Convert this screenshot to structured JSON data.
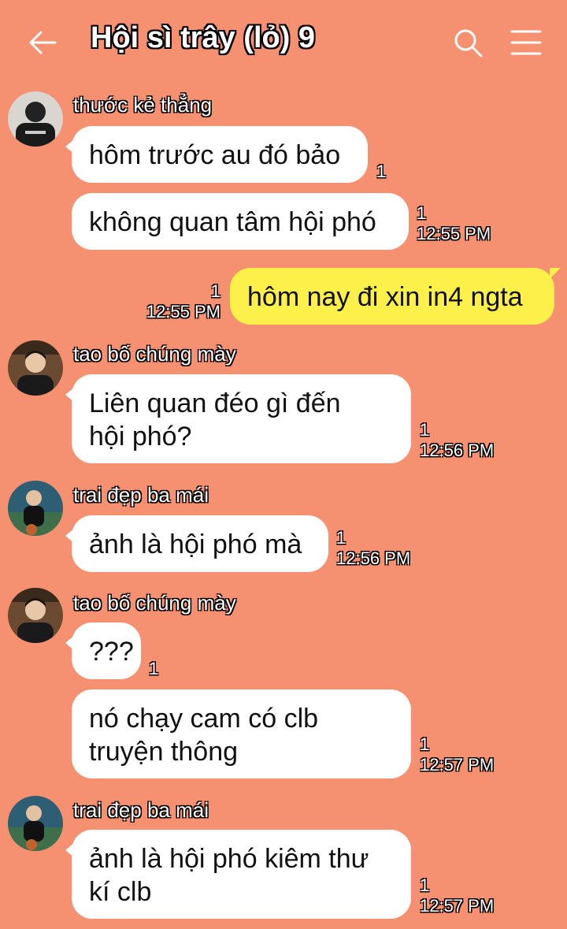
{
  "header": {
    "title": "Hội sì trây (lỏ) 9",
    "back_icon": "arrow-left-icon",
    "search_icon": "search-icon",
    "menu_icon": "hamburger-menu-icon"
  },
  "colors": {
    "background": "#f59070",
    "incoming_bubble": "#ffffff",
    "outgoing_bubble": "#fef04a"
  },
  "messages": [
    {
      "sender": "thước kẻ thẳng",
      "text": "hôm trước au đó bảo",
      "count": "1",
      "time": ""
    },
    {
      "sender": "",
      "text": "không quan tâm hội phó",
      "count": "1",
      "time": "12:55 PM"
    },
    {
      "sender": "me",
      "text": "hôm nay đi xin in4 ngta",
      "count": "1",
      "time": "12:55 PM"
    },
    {
      "sender": "tao bố chúng mày",
      "text": "Liên quan đéo gì đến hội phó?",
      "count": "1",
      "time": "12:56 PM"
    },
    {
      "sender": "trai đẹp ba mái",
      "text": "ảnh là hội phó mà",
      "count": "1",
      "time": "12:56 PM"
    },
    {
      "sender": "tao bố chúng mày",
      "text": "???",
      "count": "1",
      "time": ""
    },
    {
      "sender": "",
      "text": "nó chạy cam có clb truyện thông",
      "count": "1",
      "time": "12:57 PM"
    },
    {
      "sender": "trai đẹp ba mái",
      "text": "ảnh là hội phó kiêm thư kí clb",
      "count": "1",
      "time": "12:57 PM"
    }
  ]
}
